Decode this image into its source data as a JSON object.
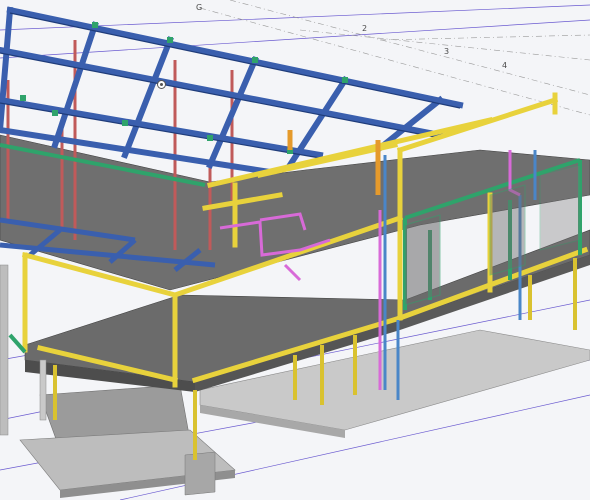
{
  "viewport": {
    "gridlines": [
      "G",
      "2",
      "3",
      "4"
    ]
  },
  "colors": {
    "beam_blue": "#3a5fae",
    "beam_blue_dark": "#1f3c7a",
    "beam_green": "#2fa36b",
    "beam_yellow": "#e8d23c",
    "beam_yellow_dark": "#b9a21f",
    "column_red": "#c05a5a",
    "column_blue": "#4a86c8",
    "pipe_magenta": "#d86ad8",
    "slab_gray": "#707070",
    "gridline_gray": "#9a9a9a",
    "gridline_purple": "#6a5ad0"
  }
}
